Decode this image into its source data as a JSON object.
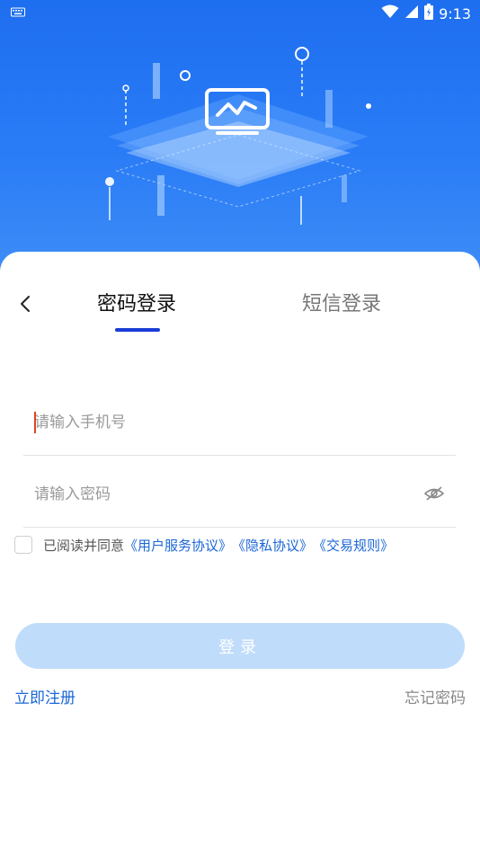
{
  "status_bar": {
    "time": "9:13",
    "icons": [
      "keyboard-icon",
      "wifi-icon",
      "signal-icon",
      "battery-icon"
    ]
  },
  "hero": {
    "illustration": "monitor-chart-icon",
    "colors": {
      "top": "#1e6ef0",
      "bottom": "#3e8df7"
    }
  },
  "tabs": [
    {
      "label": "密码登录",
      "active": true
    },
    {
      "label": "短信登录",
      "active": false
    }
  ],
  "form": {
    "phone_placeholder": "请输入手机号",
    "password_placeholder": "请输入密码"
  },
  "agreement": {
    "prefix": "已阅读并同意",
    "user_agreement": "《用户服务协议》",
    "privacy": "《隐私协议》",
    "trading_rules": "《交易规则》",
    "checked": false
  },
  "login_button": "登录",
  "register_link": "立即注册",
  "forgot_link": "忘记密码",
  "colors": {
    "accent": "#1a66d6",
    "tab_underline": "#1a3cd6",
    "login_button_disabled": "#c0dcfb"
  }
}
